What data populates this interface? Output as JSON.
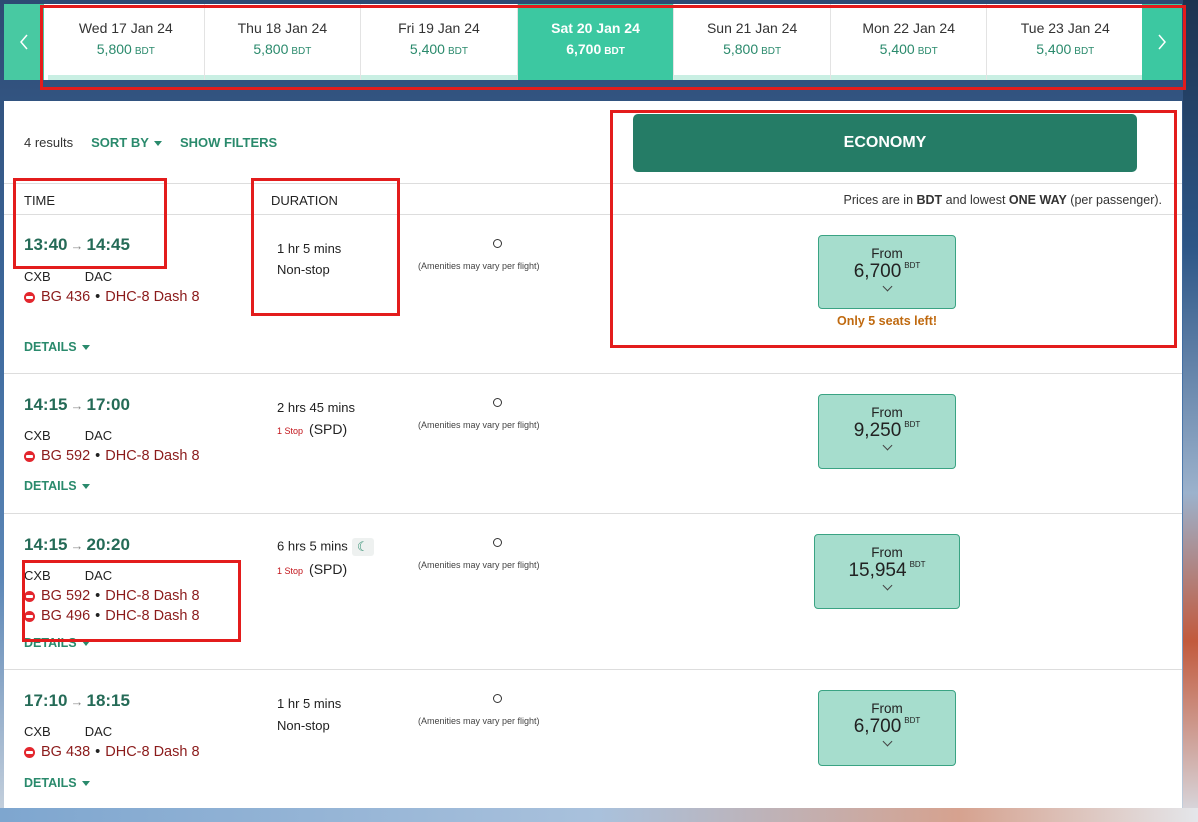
{
  "date_strip": {
    "prev_icon": "chevron-left-icon",
    "next_icon": "chevron-right-icon",
    "dates": [
      {
        "date": "Wed 17 Jan 24",
        "price": "5,800",
        "currency": "BDT",
        "active": false
      },
      {
        "date": "Thu 18 Jan 24",
        "price": "5,800",
        "currency": "BDT",
        "active": false
      },
      {
        "date": "Fri 19 Jan 24",
        "price": "5,400",
        "currency": "BDT",
        "active": false
      },
      {
        "date": "Sat 20 Jan 24",
        "price": "6,700",
        "currency": "BDT",
        "active": true
      },
      {
        "date": "Sun 21 Jan 24",
        "price": "5,800",
        "currency": "BDT",
        "active": false
      },
      {
        "date": "Mon 22 Jan 24",
        "price": "5,400",
        "currency": "BDT",
        "active": false
      },
      {
        "date": "Tue 23 Jan 24",
        "price": "5,400",
        "currency": "BDT",
        "active": false
      }
    ]
  },
  "toolbar": {
    "results_count": "4 results",
    "sort_label": "SORT BY",
    "filters_label": "SHOW FILTERS"
  },
  "cabin": {
    "label": "ECONOMY"
  },
  "headers": {
    "time": "TIME",
    "duration": "DURATION",
    "price_note_pre": "Prices are in ",
    "price_note_currency": "BDT",
    "price_note_mid": " and lowest ",
    "price_note_trip": "ONE WAY",
    "price_note_post": " (per passenger)."
  },
  "flights": [
    {
      "depart": "13:40",
      "arrive": "14:45",
      "from": "CXB",
      "to": "DAC",
      "segments": [
        {
          "flight_no": "BG 436",
          "aircraft": "DHC-8 Dash 8"
        }
      ],
      "duration": "1 hr 5 mins",
      "stops_badge": "",
      "stops_text": "Non-stop",
      "amenities": "(Amenities may vary per flight)",
      "from_label": "From",
      "price": "6,700",
      "currency": "BDT",
      "seats_left": "Only 5 seats left!",
      "details_label": "DETAILS"
    },
    {
      "depart": "14:15",
      "arrive": "17:00",
      "from": "CXB",
      "to": "DAC",
      "segments": [
        {
          "flight_no": "BG 592",
          "aircraft": "DHC-8 Dash 8"
        }
      ],
      "duration": "2 hrs 45 mins",
      "stops_badge": "1 Stop",
      "stops_text": "(SPD)",
      "amenities": "(Amenities may vary per flight)",
      "from_label": "From",
      "price": "9,250",
      "currency": "BDT",
      "seats_left": "",
      "details_label": "DETAILS"
    },
    {
      "depart": "14:15",
      "arrive": "20:20",
      "from": "CXB",
      "to": "DAC",
      "segments": [
        {
          "flight_no": "BG 592",
          "aircraft": "DHC-8 Dash 8"
        },
        {
          "flight_no": "BG 496",
          "aircraft": "DHC-8 Dash 8"
        }
      ],
      "duration": "6 hrs 5 mins",
      "stops_badge": "1 Stop",
      "stops_text": "(SPD)",
      "overnight_icon": "moon-icon",
      "amenities": "(Amenities may vary per flight)",
      "from_label": "From",
      "price": "15,954",
      "currency": "BDT",
      "seats_left": "",
      "details_label": "DETAILS"
    },
    {
      "depart": "17:10",
      "arrive": "18:15",
      "from": "CXB",
      "to": "DAC",
      "segments": [
        {
          "flight_no": "BG 438",
          "aircraft": "DHC-8 Dash 8"
        }
      ],
      "duration": "1 hr 5 mins",
      "stops_badge": "",
      "stops_text": "Non-stop",
      "amenities": "(Amenities may vary per flight)",
      "from_label": "From",
      "price": "6,700",
      "currency": "BDT",
      "seats_left": "",
      "details_label": "DETAILS"
    }
  ],
  "colors": {
    "accent": "#3cc8a1",
    "cabin_button": "#257c66",
    "price_box": "#a6ddcd",
    "flight_text": "#8b1b1b",
    "annotation_red": "#e31c1c"
  }
}
